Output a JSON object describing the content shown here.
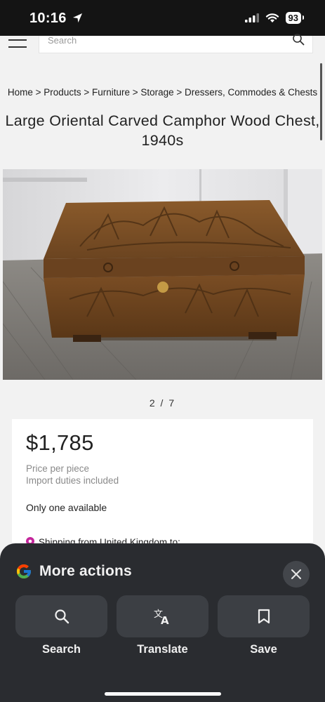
{
  "status_bar": {
    "time": "10:16",
    "battery": "93"
  },
  "search": {
    "placeholder": "Search"
  },
  "breadcrumb": "Home > Products > Furniture > Storage > Dressers, Commodes & Chests",
  "product": {
    "title": "Large Oriental Carved Camphor Wood Chest, 1940s",
    "image_counter": "2 / 7",
    "price": "$1,785",
    "price_note_1": "Price per piece",
    "price_note_2": "Import duties included",
    "availability": "Only one available",
    "shipping": "Shipping from United Kingdom to:"
  },
  "sheet": {
    "title": "More actions",
    "actions": [
      {
        "label": "Search",
        "icon": "search-icon"
      },
      {
        "label": "Translate",
        "icon": "translate-icon"
      },
      {
        "label": "Save",
        "icon": "bookmark-icon"
      }
    ]
  },
  "colors": {
    "sheet_bg": "#2a2c30",
    "action_bg": "#3c3f44",
    "pin": "#c4259b"
  }
}
